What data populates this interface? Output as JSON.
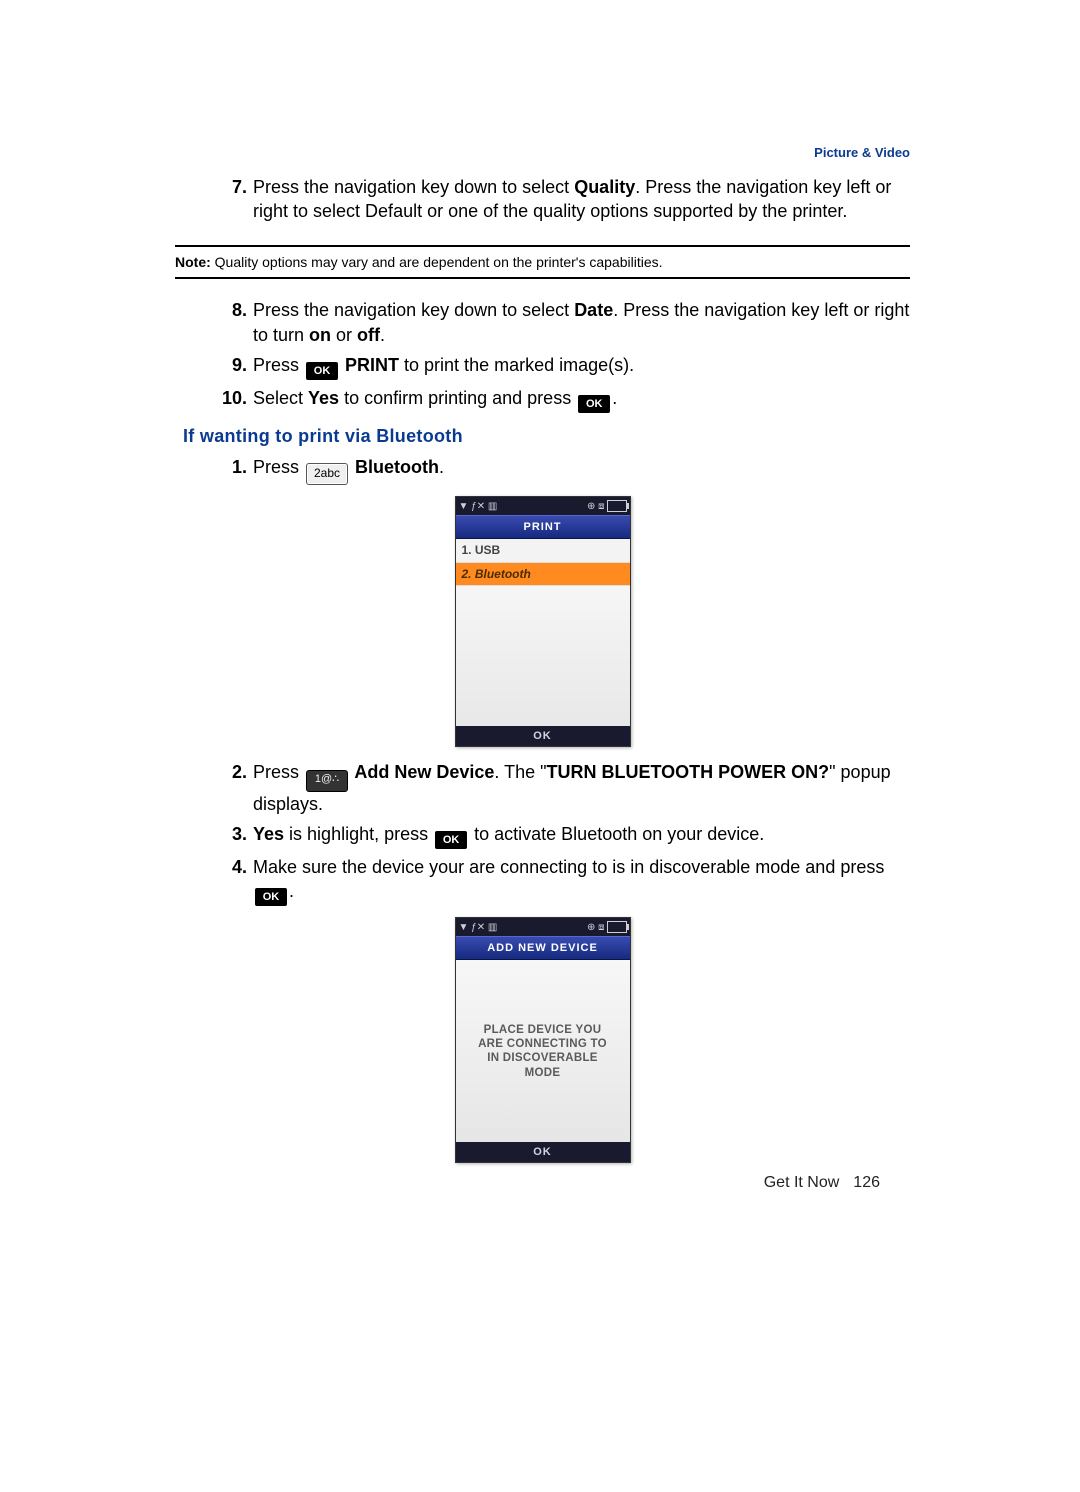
{
  "header": {
    "category": "Picture & Video"
  },
  "steps_a": {
    "num7": "7.",
    "t7_a": "Press the navigation key down to select ",
    "t7_b_bold": "Quality",
    "t7_c": ". Press the navigation key left or right to select Default or one of the quality options supported by the printer."
  },
  "note": {
    "label": "Note:",
    "text": " Quality options may vary and are dependent on the printer's capabilities."
  },
  "steps_b": {
    "num8": "8.",
    "t8_a": "Press the navigation key down to select ",
    "t8_b_bold": "Date",
    "t8_c": ". Press the navigation key left or right to turn ",
    "t8_d_bold": "on",
    "t8_e": " or ",
    "t8_f_bold": "off",
    "t8_g": ".",
    "num9": "9.",
    "t9_a": "Press ",
    "t9_ok": "OK",
    "t9_b_bold": " PRINT",
    "t9_c": " to print the marked image(s).",
    "num10": "10.",
    "t10_a": "Select ",
    "t10_b_bold": "Yes",
    "t10_c": " to confirm printing and press ",
    "t10_ok": "OK",
    "t10_d": "."
  },
  "section_heading": "If wanting to print via Bluetooth",
  "bt_steps": {
    "num1": "1.",
    "t1_a": "Press ",
    "t1_key": "2abc",
    "t1_b_bold": " Bluetooth",
    "t1_c": ".",
    "num2": "2.",
    "t2_a": "Press ",
    "t2_key": "1@∴",
    "t2_b_bold": " Add New Device",
    "t2_c": ". The \"",
    "t2_d_bold": "TURN BLUETOOTH POWER ON?",
    "t2_e": "\" popup displays.",
    "num3": "3.",
    "t3_a_bold": "Yes",
    "t3_b": " is highlight, press ",
    "t3_ok": "OK",
    "t3_c": " to activate Bluetooth on your device.",
    "num4": "4.",
    "t4_a": "Make sure the device your are connecting to is in discoverable mode and press ",
    "t4_ok": "OK",
    "t4_b": "."
  },
  "phone_print": {
    "status_left": "▼ ƒ✕ ▥",
    "status_right_icons": "⊕  ⧈",
    "title": "PRINT",
    "row1": "1. USB",
    "row2": "2. Bluetooth",
    "soft": "OK"
  },
  "phone_add": {
    "status_left": "▼ ƒ✕ ▥",
    "status_right_icons": "⊕  ⧈",
    "title": "ADD NEW DEVICE",
    "msg_l1": "PLACE DEVICE YOU",
    "msg_l2": "ARE CONNECTING TO",
    "msg_l3": "IN DISCOVERABLE",
    "msg_l4": "MODE",
    "soft": "OK"
  },
  "footer": {
    "chapter": "Get It Now",
    "page": "126"
  }
}
